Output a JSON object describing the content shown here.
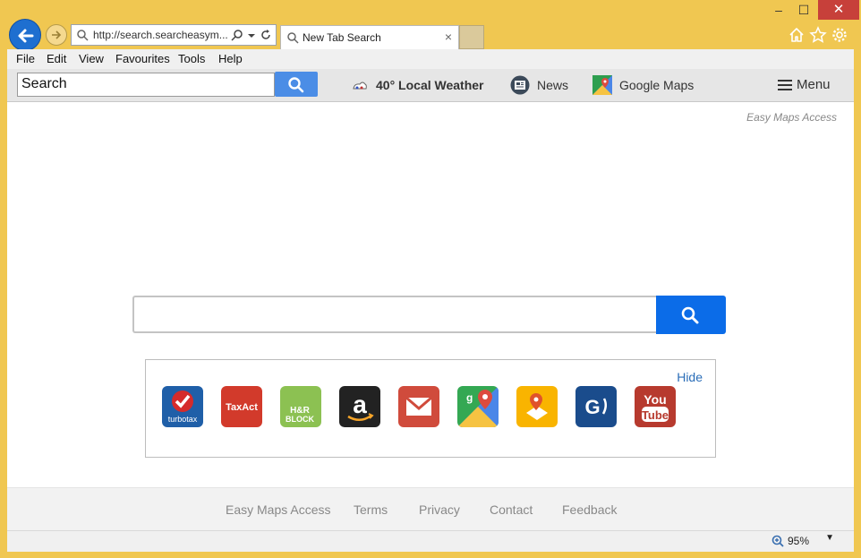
{
  "browser": {
    "address_url": "http://search.searcheasym...",
    "tab_title": "New Tab Search",
    "window_controls": {
      "minimize": "–",
      "maximize": "☐",
      "close": "✕"
    }
  },
  "menubar": [
    "File",
    "Edit",
    "View",
    "Favourites",
    "Tools",
    "Help"
  ],
  "toolbar": {
    "search_value": "Search",
    "weather_label": "40° Local Weather",
    "news_label": "News",
    "maps_label": "Google Maps",
    "menu_label": "Menu"
  },
  "page": {
    "brand": "Easy Maps Access",
    "main_search_value": "",
    "hide_label": "Hide",
    "tiles": [
      "turbotax",
      "TaxAct",
      "H&R BLOCK",
      "amazon",
      "gmail",
      "google maps",
      "maps pin",
      "G",
      "YouTube"
    ]
  },
  "footer": [
    "Easy Maps Access",
    "Terms",
    "Privacy",
    "Contact",
    "Feedback"
  ],
  "status": {
    "zoom": "95%"
  },
  "colors": {
    "accent": "#0b6ce8",
    "frame": "#f0c751",
    "close": "#c7403a"
  }
}
